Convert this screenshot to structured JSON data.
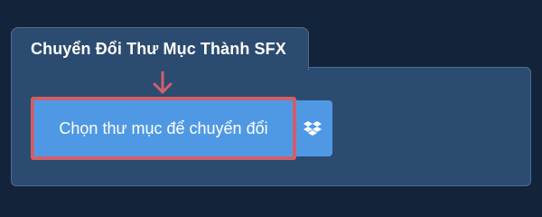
{
  "tab": {
    "title": "Chuyển Đổi Thư Mục Thành SFX"
  },
  "action": {
    "choose_folder_label": "Chọn thư mục để chuyển đổi",
    "dropbox_icon": "dropbox-icon"
  },
  "annotation": {
    "arrow_icon": "arrow-down-icon",
    "highlight_color": "#d05f69"
  },
  "colors": {
    "background": "#12233a",
    "panel": "#2b4b70",
    "panel_border": "#4f6d92",
    "button": "#4f99e4",
    "text": "#ffffff"
  }
}
